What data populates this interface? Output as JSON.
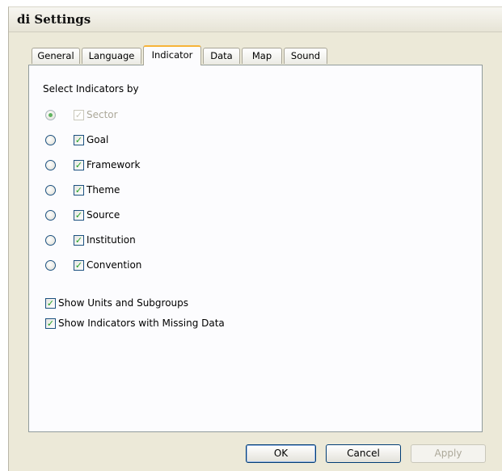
{
  "window": {
    "title": "di Settings"
  },
  "tabs": [
    {
      "label": "General"
    },
    {
      "label": "Language"
    },
    {
      "label": "Indicator"
    },
    {
      "label": "Data"
    },
    {
      "label": "Map"
    },
    {
      "label": "Sound"
    }
  ],
  "active_tab": "Indicator",
  "indicator": {
    "section_label": "Select Indicators by",
    "options": [
      {
        "label": "Sector",
        "radio_selected": true,
        "checked": true,
        "disabled": true
      },
      {
        "label": "Goal",
        "radio_selected": false,
        "checked": true,
        "disabled": false
      },
      {
        "label": "Framework",
        "radio_selected": false,
        "checked": true,
        "disabled": false
      },
      {
        "label": "Theme",
        "radio_selected": false,
        "checked": true,
        "disabled": false
      },
      {
        "label": "Source",
        "radio_selected": false,
        "checked": true,
        "disabled": false
      },
      {
        "label": "Institution",
        "radio_selected": false,
        "checked": true,
        "disabled": false
      },
      {
        "label": "Convention",
        "radio_selected": false,
        "checked": true,
        "disabled": false
      }
    ],
    "show_units": {
      "label": "Show Units and Subgroups",
      "checked": true
    },
    "show_missing": {
      "label": "Show Indicators with Missing Data",
      "checked": true
    }
  },
  "buttons": {
    "ok": "OK",
    "cancel": "Cancel",
    "apply": "Apply"
  },
  "colors": {
    "dialog_bg": "#ece9d8",
    "panel_bg": "#fcfcfe",
    "active_tab_accent": "#f7b338",
    "check_green": "#21a121"
  }
}
